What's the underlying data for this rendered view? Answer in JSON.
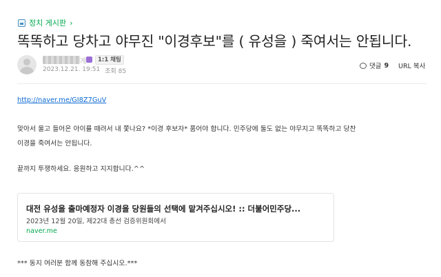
{
  "board": {
    "label": "정치 게시판",
    "chevron": "›"
  },
  "post": {
    "title": "똑똑하고 당차고 야무진 \"이경후보\"를 ( 유성을 ) 죽여서는 안됩니다.",
    "author": {
      "nick_tail": "게",
      "chat_badge": "1:1 채팅"
    },
    "date": "2023.12.21. 19:51",
    "views": "조회 85",
    "comments_label": "댓글",
    "comments_count": "9",
    "url_copy": "URL 복사"
  },
  "content": {
    "link": "http://naver.me/GI8Z7GuV",
    "para1_line1": "맞아서 울고 들어온 아이를 때려서 내 쫓나요? *이경 후보자* 품어야 합니다. 민주당에 둘도 없는 야무지고 똑똑하고 당찬",
    "para1_line2": "이경을 죽여서는 안됩니다.",
    "para2": "끝까지 투쟁하세요. 응원하고 지지합니다.^^",
    "card": {
      "title": "대전 유성을 출마예정자 이경을 당원들의 선택에 맡겨주십시오! :: 더불어민주당...",
      "desc": "2023년 12월 20일, 제22대 총선 검증위원회에서",
      "domain": "naver.me"
    },
    "footer": "*** 동지 여러분 함께 동참해 주십시오.***"
  }
}
